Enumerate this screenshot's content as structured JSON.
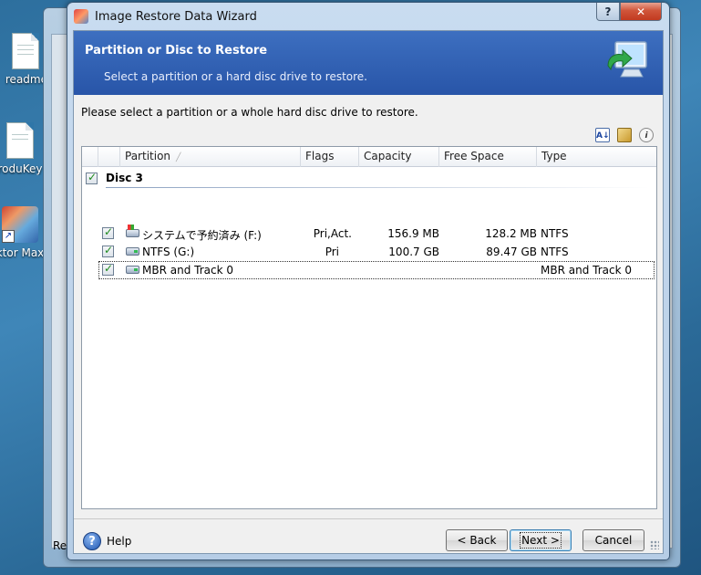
{
  "desktop": {
    "icons": [
      {
        "label": "readme"
      },
      {
        "label": "roduKey"
      },
      {
        "label": "ktor Max"
      }
    ],
    "bg_window_text": "Re"
  },
  "dialog": {
    "title": "Image Restore Data Wizard",
    "help_glyph": "?",
    "close_glyph": "✕"
  },
  "banner": {
    "heading": "Partition or Disc to Restore",
    "subheading": "Select a partition or a hard disc drive to restore."
  },
  "instruction": "Please select a partition or a whole hard disc drive to restore.",
  "toolbar": {
    "sort_icon": "sort-az-icon",
    "properties_icon": "properties-icon",
    "info_icon": "info-icon"
  },
  "list": {
    "columns": [
      {
        "label": "Partition",
        "sort": "ascending"
      },
      {
        "label": "Flags"
      },
      {
        "label": "Capacity"
      },
      {
        "label": "Free Space"
      },
      {
        "label": "Type"
      }
    ],
    "group": {
      "label": "Disc 3",
      "checked": true
    },
    "rows": [
      {
        "partition": "システムで予約済み (F:)",
        "flags": "Pri,Act.",
        "capacity": "156.9 MB",
        "free_space": "128.2 MB",
        "type": "NTFS",
        "checked": true,
        "icon": "windows-drive-icon"
      },
      {
        "partition": "NTFS (G:)",
        "flags": "Pri",
        "capacity": "100.7 GB",
        "free_space": "89.47 GB",
        "type": "NTFS",
        "checked": true,
        "icon": "drive-icon"
      },
      {
        "partition": "MBR and Track 0",
        "flags": "",
        "capacity": "",
        "free_space": "",
        "type": "MBR and Track 0",
        "checked": true,
        "icon": "drive-icon",
        "focused": true
      }
    ]
  },
  "footer": {
    "help_label": "Help",
    "back_label": "< Back",
    "next_label": "Next >",
    "cancel_label": "Cancel"
  }
}
